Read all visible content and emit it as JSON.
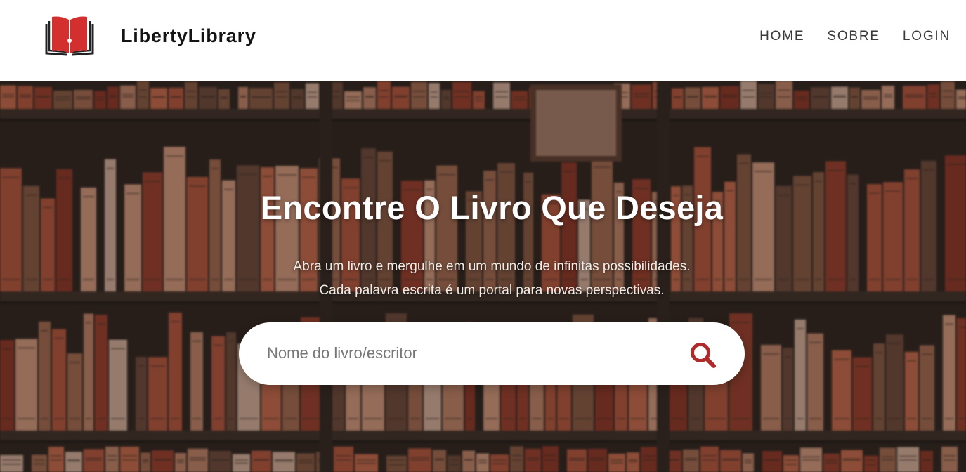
{
  "header": {
    "brand": "LibertyLibrary",
    "nav": [
      "HOME",
      "SOBRE",
      "LOGIN"
    ]
  },
  "hero": {
    "title": "Encontre O Livro Que Deseja",
    "subtitle_lines": [
      "Abra um livro e mergulhe em um mundo de infinitas possibilidades.",
      "Cada palavra escrita é um portal para novas perspectivas."
    ]
  },
  "search": {
    "placeholder": "Nome do livro/escritor",
    "value": ""
  },
  "icons": {
    "logo": "open-book-logo-icon",
    "search": "search-icon"
  },
  "colors": {
    "accent": "#b12a2a",
    "logo_red": "#d32f2f",
    "header_bg": "#ffffff",
    "nav_text": "#3a3a3a"
  }
}
